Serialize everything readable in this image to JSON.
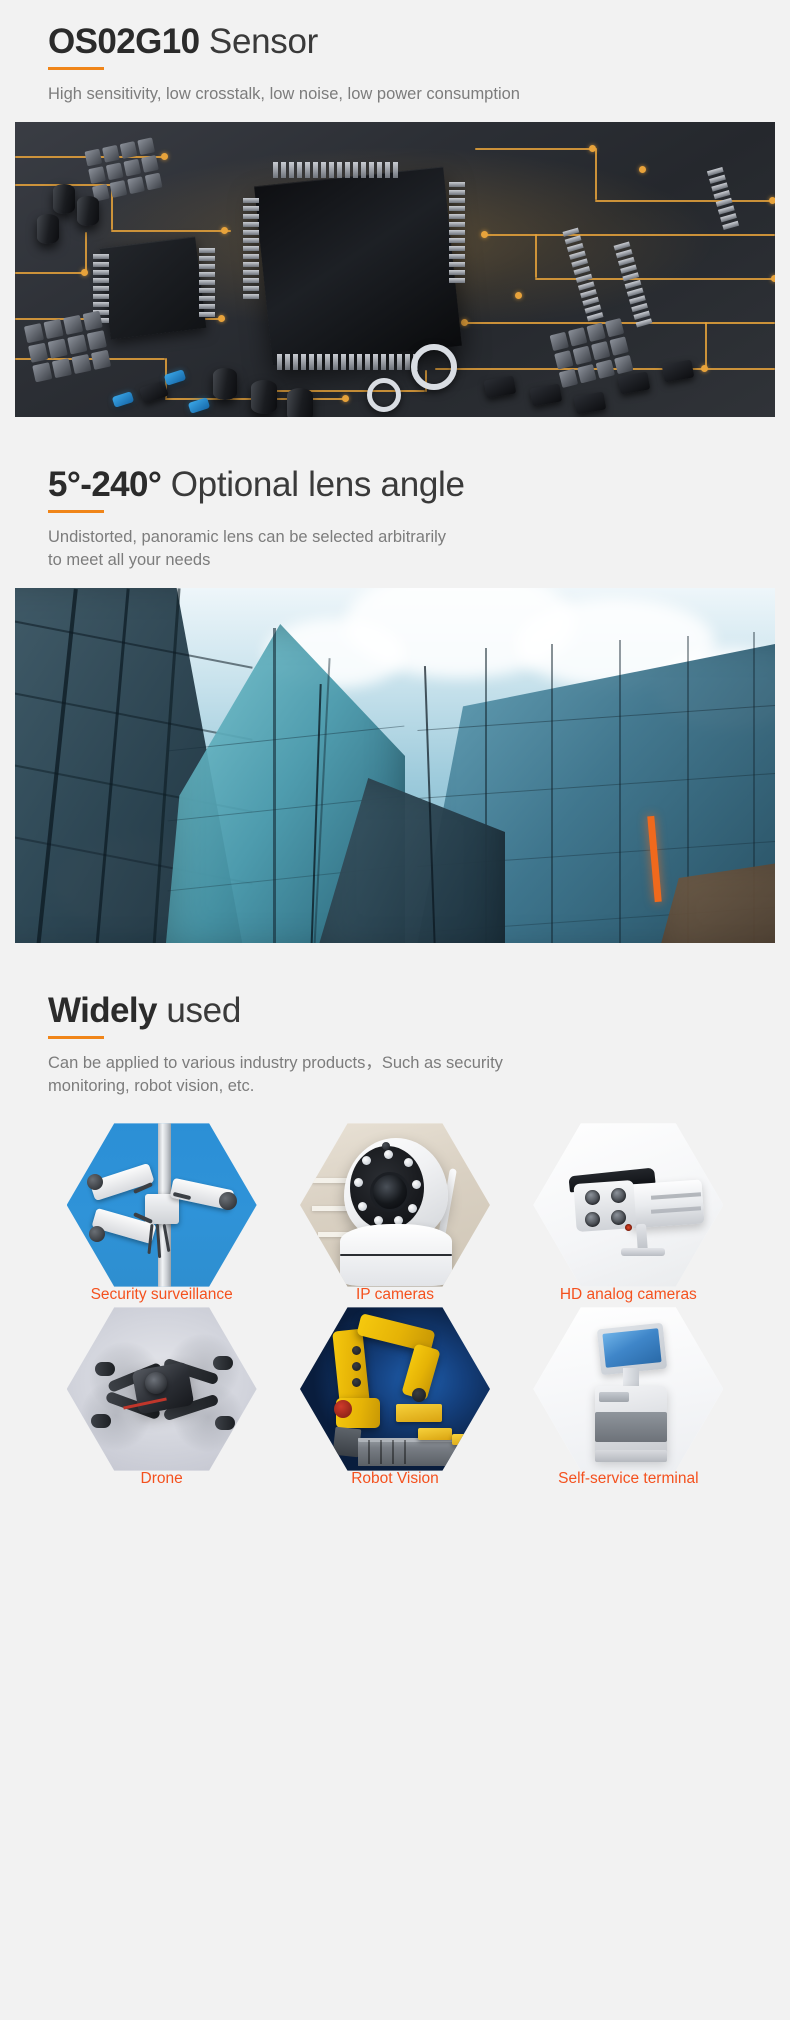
{
  "sections": [
    {
      "id": "sensor",
      "title_strong": "OS02G10",
      "title_light": " Sensor",
      "subtitle": "High sensitivity, low crosstalk, low noise, low power consumption",
      "image_alt": "pcb-circuit-board-macro"
    },
    {
      "id": "lens",
      "title_strong": "5°-240°",
      "title_light": " Optional lens angle",
      "subtitle_line1": "Undistorted, panoramic lens can be selected arbitrarily",
      "subtitle_line2": "to meet all your needs",
      "image_alt": "glass-skyscrapers-looking-up"
    },
    {
      "id": "applications",
      "title_strong": "Widely",
      "title_light": " used",
      "subtitle_line1": "Can be applied to various industry products，Such as security",
      "subtitle_line2": "monitoring, robot vision, etc."
    }
  ],
  "applications": {
    "items": [
      {
        "label": "Security surveillance",
        "art": "security-surveillance-cameras-on-pole"
      },
      {
        "label": "IP cameras",
        "art": "white-ptz-ip-camera"
      },
      {
        "label": "HD analog cameras",
        "art": "white-bullet-analog-camera"
      },
      {
        "label": "Drone",
        "art": "quadcopter-drone-in-flight"
      },
      {
        "label": "Robot Vision",
        "art": "yellow-industrial-robot-arm"
      },
      {
        "label": "Self-service terminal",
        "art": "self-service-kiosk-terminal"
      }
    ]
  },
  "theme": {
    "page_background": "#f2f2f2",
    "accent_rule": "#f08519",
    "label_orange": "#f4511e",
    "heading_color": "#333333",
    "subtitle_color": "#7c7c7c"
  }
}
